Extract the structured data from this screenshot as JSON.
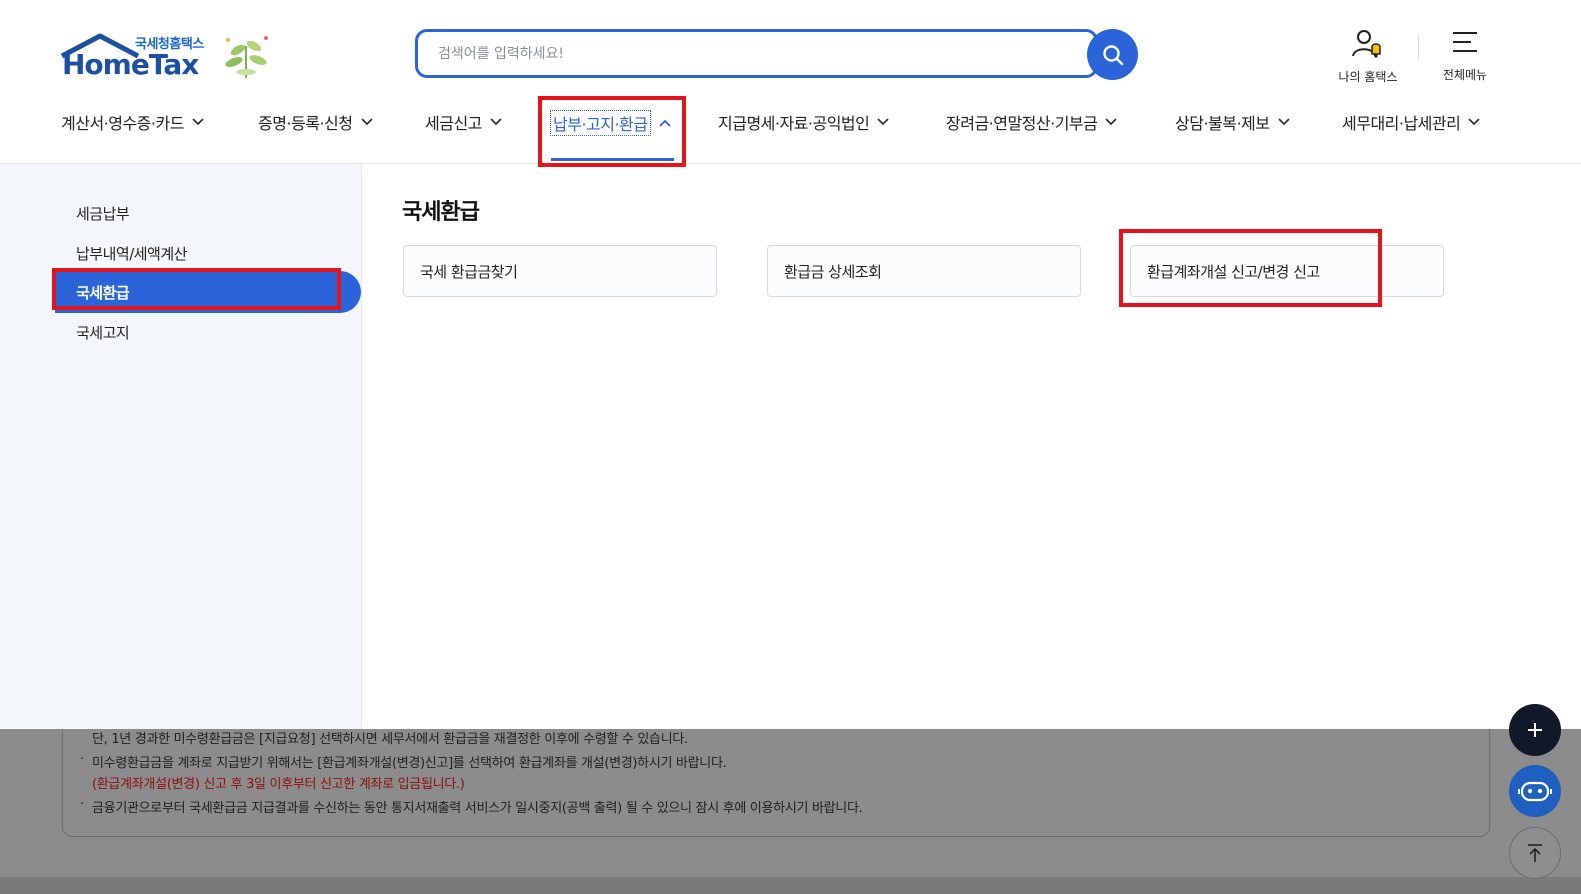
{
  "header": {
    "logo_sub": "국세청홈택스",
    "logo_main": "HomeTax",
    "search_placeholder": "검색어를 입력하세요!",
    "my_hometax": "나의 홈택스",
    "all_menu": "전체메뉴"
  },
  "gnb": [
    {
      "label": "계산서·영수증·카드"
    },
    {
      "label": "증명·등록·신청"
    },
    {
      "label": "세금신고"
    },
    {
      "label": "납부·고지·환급"
    },
    {
      "label": "지급명세·자료·공익법인"
    },
    {
      "label": "장려금·연말정산·기부금"
    },
    {
      "label": "상담·불복·제보"
    },
    {
      "label": "세무대리·납세관리"
    }
  ],
  "lnb": [
    {
      "label": "세금납부"
    },
    {
      "label": "납부내역/세액계산"
    },
    {
      "label": "국세환급"
    },
    {
      "label": "국세고지"
    }
  ],
  "content": {
    "title": "국세환급",
    "cards": [
      {
        "label": "국세 환급금찾기"
      },
      {
        "label": "환급금 상세조회"
      },
      {
        "label": "환급계좌개설 신고/변경 신고"
      }
    ]
  },
  "notices": {
    "line1": "단, 1년 경과한 미수령환급금은 [지급요청] 선택하시면 세무서에서 환급금을 재결정한 이후에 수령할 수 있습니다.",
    "line2": "미수령환급금을 계좌로 지급받기 위해서는 [환급계좌개설(변경)신고]를 선택하여 환급계좌를 개설(변경)하시기 바랍니다.",
    "line3": "(환급계좌개설(변경) 신고 후 3일 이후부터 신고한 계좌로 입금됩니다.)",
    "line4": "금융기관으로부터 국세환급금 지급결과를 수신하는 동안 통지서재출력 서비스가 일시중지(공백 출력) 될 수 있으니 잠시 후에 이용하시기 바랍니다."
  },
  "colors": {
    "accent": "#2b63d9",
    "highlight": "#e3141c",
    "notice_red": "#8a1010"
  }
}
